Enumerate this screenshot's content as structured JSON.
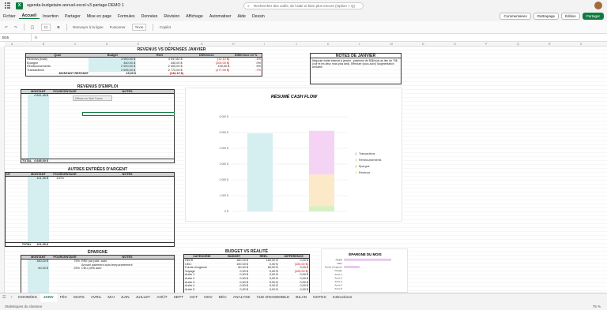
{
  "titlebar": {
    "doc_title": "agenda-budgetaire-annuel-excel-v3-partage-DEMO 1",
    "search_placeholder": "Rechercher des outils, de l'aide et bien plus encore (Option + Q)"
  },
  "menu": {
    "items": [
      "Fichier",
      "Accueil",
      "Insertion",
      "Partager",
      "Mise en page",
      "Formules",
      "Données",
      "Révision",
      "Affichage",
      "Automatiser",
      "Aide",
      "Dessin"
    ],
    "active": "Accueil",
    "comments": "Commentaires",
    "catchup": "Rattrapage",
    "editing": "Édition",
    "share": "Partager"
  },
  "ribbon": {
    "font_size": "11",
    "wrap": "Renvoyer à la ligne",
    "merge": "Fusionner",
    "format": "Texte",
    "copilot": "Copilot"
  },
  "formula_bar": {
    "cell_ref": "B16",
    "fx": "fx"
  },
  "columns": [
    "A",
    "B",
    "C",
    "D",
    "E",
    "F",
    "G",
    "H",
    "I",
    "J",
    "K",
    "L",
    "M",
    "N",
    "O",
    "P",
    "Q",
    "R",
    "S"
  ],
  "revenus_vs_depenses": {
    "title": "REVENUS VS DÉPENSES JANVIER",
    "headers": [
      "Quoi",
      "Budget",
      "Réel",
      "Différence",
      "Différence en %"
    ],
    "rows": [
      [
        "Revenus (total)",
        "3 900,00 $",
        "4 947,82 $",
        "(12,12 $)",
        "-1%"
      ],
      [
        "Épargne",
        "340,00 $",
        "340,00 $",
        "(200,00 $)",
        "0%"
      ],
      [
        "Remboursements",
        "2 900,00 $",
        "2 000,00 $",
        "100,00 $",
        "5%"
      ],
      [
        "Transactions",
        "2 595,00 $",
        "2 772,00 $",
        "(177,00 $)",
        "-7%"
      ]
    ],
    "total_label": "MONTANT RESTANT",
    "total_budget": "15,00 $",
    "total_reel": "(134,10 $)"
  },
  "notes": {
    "title": "NOTES DE JANVIER",
    "text": "Négocier forfait internet à janvier - paiement de 50$/mois au lieu de 70$ (voir et les deux mois plus tard). Effectuer (sous-suivi) l'augmentation annuelle."
  },
  "revenus_emploi": {
    "title": "REVENUS D'EMPLOI",
    "headers": [
      "MONTANT",
      "POURCENTAGE",
      "NOTES"
    ],
    "first_value": "4 841,46 $",
    "total_label": "TOTAL",
    "total_value": "4 845,00 $",
    "comment_tip": "Diffuse sur Web Frame"
  },
  "autres_entrees": {
    "title": "AUTRES ENTRÉES D'ARGENT",
    "headers": [
      "NT",
      "MONTANT",
      "POURCENTAGE",
      "NOTES"
    ],
    "first_value": "101,35 $",
    "first_pct": "100%",
    "total_label": "TOTAL",
    "total_value": "101,35 $"
  },
  "epargne": {
    "title": "ÉPARGNE",
    "headers": [
      "MONTANT",
      "POURCENTAGE",
      "NOTES"
    ],
    "rows": [
      [
        "180,00 $",
        "75%",
        "REE par paie, auto"
      ],
      [
        "",
        "",
        "Annuel paiement auto temporairement"
      ],
      [
        "60,00 $",
        "25%",
        "CELI pers auto"
      ]
    ]
  },
  "budget_vs_realite": {
    "title": "BUDGET VS RÉALITÉ",
    "headers": [
      "CATÉGORIE",
      "BUDGET",
      "RÉEL",
      "DIFFÉRENCE"
    ],
    "rows": [
      [
        "REER",
        "180,00 $",
        "180,00 $",
        "0,00 $"
      ],
      [
        "CELI",
        "100,00 $",
        "0,00 $",
        "(100,00 $)"
      ],
      [
        "Fonds d'urgence",
        "60,00 $",
        "60,00 $",
        "0,00 $"
      ],
      [
        "Voyage",
        "0,00 $",
        "0,00 $",
        "(100,00 $)"
      ],
      [
        "Autre 1",
        "0,00 $",
        "0,00 $",
        "0,00 $"
      ],
      [
        "Autre 2",
        "0,00 $",
        "0,00 $",
        "0,00 $"
      ],
      [
        "Autre 3",
        "0,00 $",
        "0,00 $",
        "0,00 $"
      ],
      [
        "Autre 4",
        "0,00 $",
        "0,00 $",
        "0,00 $"
      ],
      [
        "Autre 5",
        "0,00 $",
        "0,00 $",
        "0,00 $"
      ]
    ]
  },
  "epargne_mois": {
    "title": "ÉPARGNE DU MOIS",
    "labels": [
      "REER",
      "CELI",
      "Fonds d'urgence",
      "Voyage",
      "Autre 1",
      "Autre 2",
      "Autre 3",
      "Autre 4",
      "Autre 5"
    ],
    "values": [
      180,
      0,
      60,
      0,
      0,
      0,
      0,
      0,
      0
    ]
  },
  "chart_data": {
    "type": "bar",
    "title": "RÉSUMÉ CASH FLOW",
    "categories": [
      "Entrées",
      "Sorties"
    ],
    "series": [
      {
        "name": "Transactions",
        "values": [
          4947,
          2772
        ],
        "color": "#f5d3f5"
      },
      {
        "name": "Remboursements",
        "values": [
          0,
          2000
        ],
        "color": "#fbe9c8"
      },
      {
        "name": "Épargne",
        "values": [
          0,
          340
        ],
        "color": "#d6f0c2"
      },
      {
        "name": "Revenus",
        "values": [
          0,
          0
        ],
        "color": "#fff4c2"
      }
    ],
    "entrees_color": "#d5eef0",
    "yticks": [
      "0 $",
      "1 000 $",
      "2 000 $",
      "3 000 $",
      "4 000 $",
      "5 000 $",
      "6 000 $"
    ],
    "ylim": [
      0,
      6000
    ],
    "legend_position": "right"
  },
  "tabs": {
    "items": [
      "DONNÉES",
      "JANV",
      "FÉV",
      "MARS",
      "AVRIL",
      "MAI",
      "JUIN",
      "JUILLET",
      "AOÛT",
      "SEPT",
      "OCT",
      "NOV",
      "DÉC",
      "ANALYSE",
      "VUE D'ENSEMBLE",
      "BILAN",
      "NOTES",
      "Instructions"
    ],
    "active": "JANV"
  },
  "status": {
    "left": "Statistiques du classeur",
    "zoom": "75 %"
  }
}
